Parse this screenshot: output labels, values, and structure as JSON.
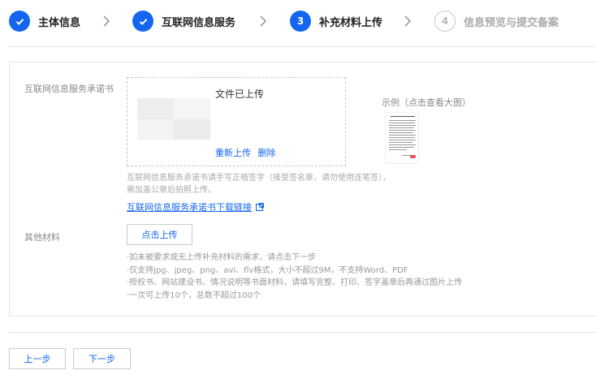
{
  "steps": [
    {
      "label": "主体信息",
      "state": "done",
      "icon": "check-icon"
    },
    {
      "label": "互联网信息服务",
      "state": "done",
      "icon": "check-icon"
    },
    {
      "label": "补充材料上传",
      "state": "active",
      "number": "3"
    },
    {
      "label": "信息预览与提交备案",
      "state": "todo",
      "number": "4"
    }
  ],
  "commitment": {
    "label": "互联网信息服务承诺书",
    "status": "文件已上传",
    "reupload": "重新上传",
    "delete": "删除",
    "example_label": "示例（点击查看大图）",
    "hint_line1": "互联网信息服务承诺书请手写正楷签字（接受签名章，请勿使用连笔签），",
    "hint_line2": "需加盖公章后拍照上传。",
    "download_link": "互联网信息服务承诺书下载链接"
  },
  "other": {
    "label": "其他材料",
    "upload_button": "点击上传",
    "rules": [
      "·如未被要求或无上传补充材料的需求，请点击下一步",
      "·仅支持jpg、jpeg、png、avi、flv格式，大小不超过9M，不支持Word、PDF",
      "·授权书、网站建设书、情况说明等书面材料，请填写完整、打印、签字盖章后再通过图片上传",
      "·一次可上传10个，总数不超过100个"
    ]
  },
  "footer": {
    "prev": "上一步",
    "next": "下一步"
  },
  "colors": {
    "primary": "#1466f0",
    "border": "#e5e5e5",
    "muted": "#aaaaaa"
  }
}
